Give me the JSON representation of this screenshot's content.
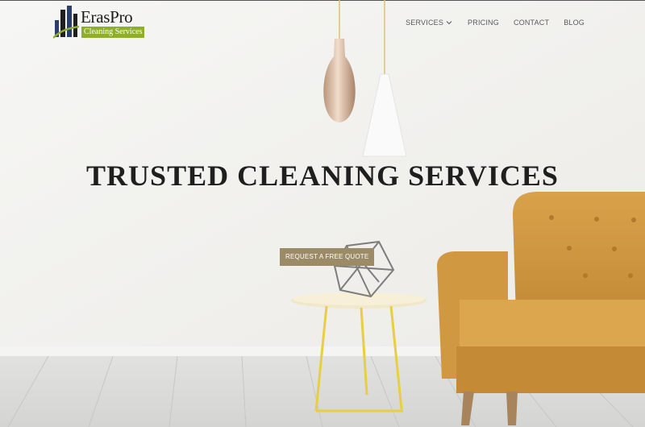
{
  "brand": {
    "name": "ErasPro",
    "tagline": "Cleaning Services",
    "accent_color": "#8fae2e"
  },
  "nav": {
    "items": [
      {
        "label": "SERVICES",
        "has_dropdown": true
      },
      {
        "label": "PRICING",
        "has_dropdown": false
      },
      {
        "label": "CONTACT",
        "has_dropdown": false
      },
      {
        "label": "BLOG",
        "has_dropdown": false
      }
    ]
  },
  "hero": {
    "title": "TRUSTED CLEANING SERVICES",
    "cta_label": "REQUEST A FREE QUOTE",
    "cta_color": "#9b8b66"
  },
  "icons": [
    "logo-buildings-icon",
    "chevron-down-icon"
  ]
}
